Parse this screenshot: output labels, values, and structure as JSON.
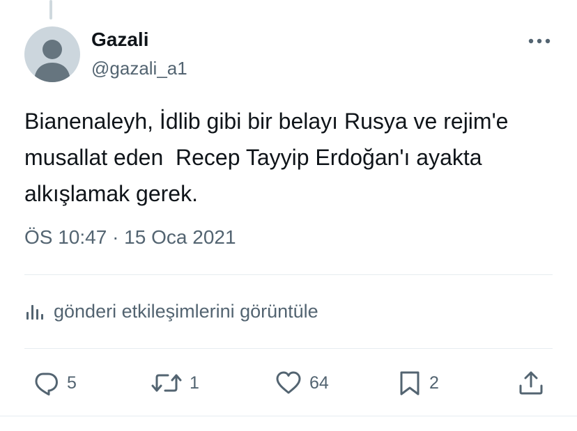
{
  "tweet": {
    "display_name": "Gazali",
    "handle": "@gazali_a1",
    "text": "Bianenaleyh, İdlib gibi bir belayı Rusya ve rejim'e\nmusallat eden  Recep Tayyip Erdoğan'ı ayakta\nalkışlamak gerek.",
    "timestamp": "ÖS 10:47 · 15 Oca 2021"
  },
  "engagements": {
    "label": "gönderi etkileşimlerini görüntüle",
    "icon": "bar-chart-icon"
  },
  "actions": {
    "replies": "5",
    "retweets": "1",
    "likes": "64",
    "bookmarks": "2"
  },
  "icons": {
    "more": "ellipsis-icon",
    "reply": "comment-bubble-icon",
    "retweet": "retweet-arrows-icon",
    "like": "heart-icon",
    "bookmark": "bookmark-icon",
    "share": "share-upload-icon"
  },
  "colors": {
    "text": "#0f1419",
    "secondary": "#536471",
    "divider": "#e6ecf0",
    "avatar_bg": "#ccd6dd",
    "avatar_fg": "#66757f"
  }
}
